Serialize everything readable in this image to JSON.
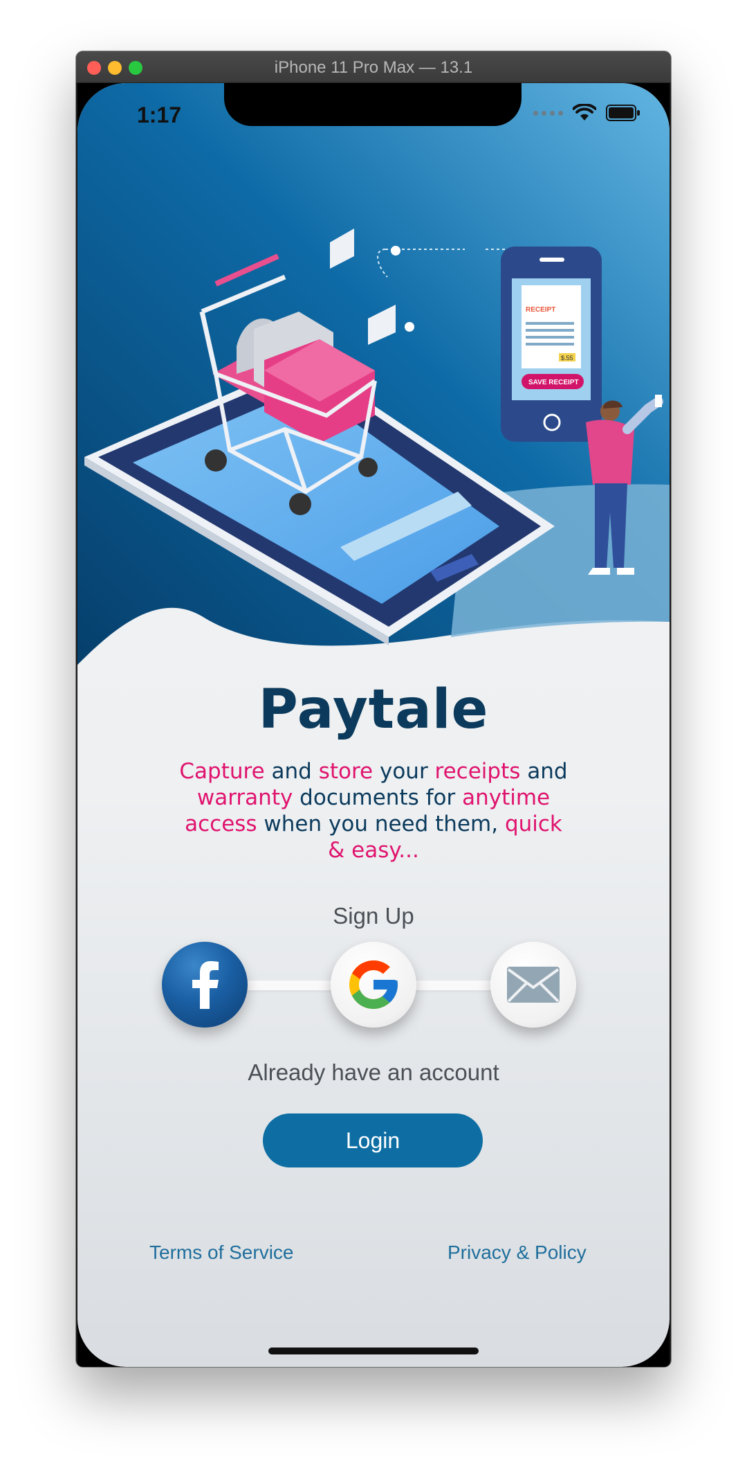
{
  "window": {
    "title": "iPhone 11 Pro Max — 13.1"
  },
  "status_bar": {
    "time": "1:17",
    "icons": [
      "cellular-signal-icon",
      "wifi-icon",
      "battery-icon"
    ]
  },
  "hero": {
    "illustration": "shopping-cart-phone-receipt-illustration",
    "phone_receipt_heading": "RECEIPT",
    "phone_receipt_amount": "$.55",
    "phone_button_label": "SAVE RECEIPT"
  },
  "app": {
    "title": "Paytale",
    "tagline": [
      {
        "text": "Capture",
        "highlight": true
      },
      {
        "text": " and ",
        "highlight": false
      },
      {
        "text": "store",
        "highlight": true
      },
      {
        "text": " your ",
        "highlight": false
      },
      {
        "text": "receipts",
        "highlight": true
      },
      {
        "text": " and ",
        "highlight": false
      },
      {
        "text": "warranty",
        "highlight": true
      },
      {
        "text": " documents for ",
        "highlight": false
      },
      {
        "text": "anytime access",
        "highlight": true
      },
      {
        "text": " when you need them, ",
        "highlight": false
      },
      {
        "text": "quick & easy...",
        "highlight": true
      }
    ]
  },
  "signup": {
    "label": "Sign Up",
    "providers": [
      {
        "name": "facebook",
        "icon": "facebook-icon"
      },
      {
        "name": "google",
        "icon": "google-icon"
      },
      {
        "name": "email",
        "icon": "mail-icon"
      }
    ]
  },
  "login": {
    "prompt": "Already have an account",
    "button_label": "Login"
  },
  "footer": {
    "terms": "Terms of Service",
    "privacy": "Privacy & Policy"
  },
  "colors": {
    "title": "#0b3a5c",
    "highlight": "#e0136e",
    "login_button": "#0e6ea3",
    "link": "#1f6e9c",
    "hero_dark": "#0b4f83",
    "hero_light": "#5fb0dd"
  }
}
